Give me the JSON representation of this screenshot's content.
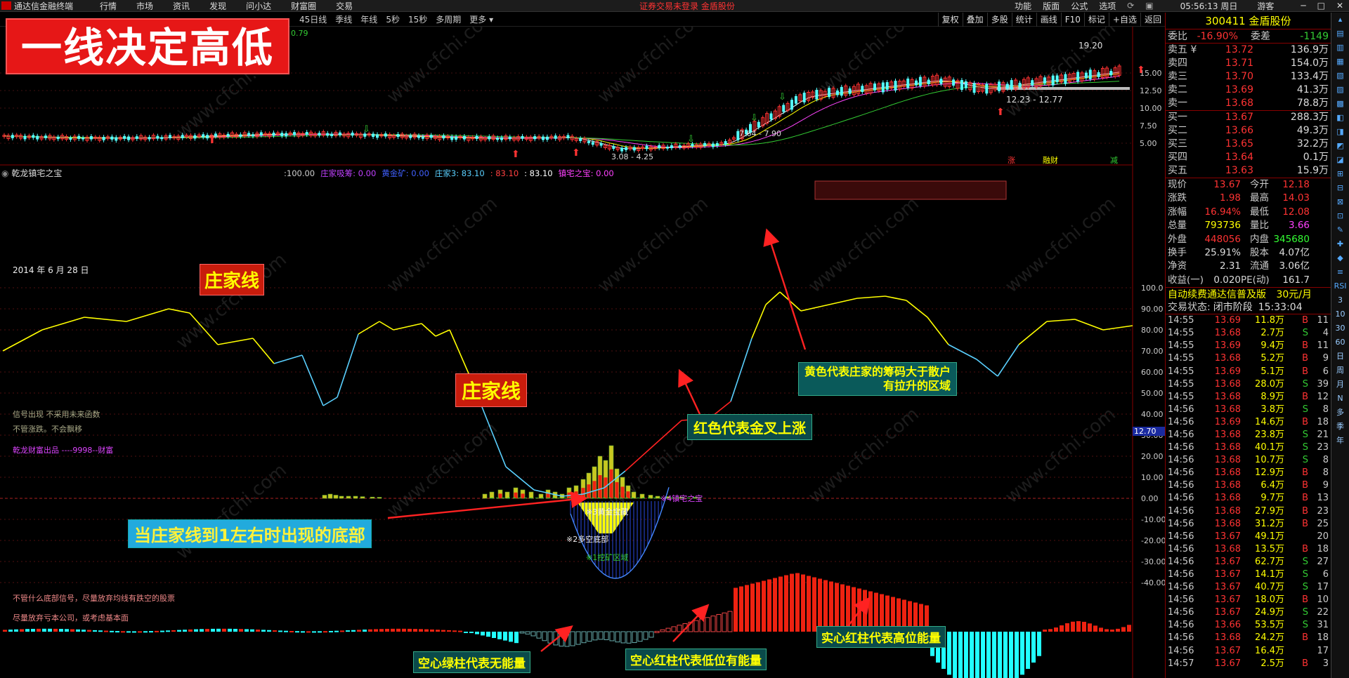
{
  "menubar": {
    "app_title": "通达信金融终端",
    "items": [
      "行情",
      "市场",
      "资讯",
      "发现",
      "问小达",
      "财富圈",
      "交易"
    ],
    "notice": "证券交易未登录  金盾股份",
    "right_items": [
      "功能",
      "版面",
      "公式",
      "选项"
    ],
    "time": "05:56:13 周日",
    "user": "游客"
  },
  "period_bar": {
    "periods": [
      "45日线",
      "季线",
      "年线",
      "5秒",
      "15秒",
      "多周期",
      "更多"
    ],
    "tools": [
      "复权",
      "叠加",
      "多股",
      "统计",
      "画线",
      "F10",
      "标记",
      "+自选",
      "返回"
    ]
  },
  "banner": {
    "text": "一线决定高低"
  },
  "kline": {
    "price_labels": [
      "15.00",
      "12.50",
      "10.00",
      "7.50",
      "5.00"
    ],
    "high_label": "19.20",
    "range_label_1": "12.23 - 12.77",
    "range_label_2": "7.64 - 7.90",
    "range_label_3": "3.08 - 4.25",
    "ma_value": "0.79",
    "event_labels": [
      "涨",
      "融财",
      "减"
    ]
  },
  "indicator": {
    "name": "乾龙镇宅之宝",
    "values_line": [
      {
        "text": ":100.00",
        "color": "#cccccc"
      },
      {
        "text": "庄家吸筹: 0.00",
        "color": "#c040ff"
      },
      {
        "text": "黄金矿: 0.00",
        "color": "#4060ff"
      },
      {
        "text": "庄家3: 83.10",
        "color": "#5ad0ff"
      },
      {
        "text": ": 83.10",
        "color": "#ff4040"
      },
      {
        "text": ": 83.10",
        "color": "#ffffff"
      },
      {
        "text": "镇宅之宝: 0.00",
        "color": "#ff40ff"
      }
    ],
    "axis_labels": [
      "100.0",
      "90.00",
      "80.00",
      "70.00",
      "60.00",
      "50.00",
      "40.00",
      "30.00",
      "20.00",
      "10.00",
      "0.00",
      "-10.00",
      "-20.00",
      "-30.00",
      "-40.00"
    ],
    "current_marker": "12.70",
    "date_label": "2014 年 6 月 28 日",
    "note_1": "信号出现 不采用未来函数",
    "note_2": "不管涨跌。不会飘移",
    "note_3": "乾龙财富出品 ----9998--财富",
    "note_4": "不管什么底部信号，尽量放弃均线有跌空的股票",
    "note_5": "尽量放弃亏本公司，或考虑基本面",
    "zone_1": "※3黄金宝藏",
    "zone_2": "※2多空底部",
    "zone_3": "※1挖矿区域",
    "zone_4": "※4镇宅之宝"
  },
  "annotations": {
    "zhuangjia_1": "庄家线",
    "zhuangjia_2": "庄家线",
    "yellow_line": "黄色代表庄家的筹码大于散户",
    "yellow_line_2": "有拉升的区域",
    "red_line": "红色代表金叉上涨",
    "bottom": "当庄家线到1左右时出现的底部",
    "hollow_green": "空心绿柱代表无能量",
    "hollow_red": "空心红柱代表低位有能量",
    "solid_red": "实心红柱代表高位能量"
  },
  "watermark": "www.cfchi.com",
  "quote": {
    "code": "300411",
    "name": "金盾股份",
    "wei_bi_label": "委比",
    "wei_bi": "-16.90%",
    "wei_cha_label": "委差",
    "wei_cha": "-1149",
    "asks": [
      {
        "label": "卖五 ¥",
        "price": "13.72",
        "vol": "136.9万"
      },
      {
        "label": "卖四",
        "price": "13.71",
        "vol": "154.0万"
      },
      {
        "label": "卖三",
        "price": "13.70",
        "vol": "133.4万"
      },
      {
        "label": "卖二",
        "price": "13.69",
        "vol": "41.3万"
      },
      {
        "label": "卖一",
        "price": "13.68",
        "vol": "78.8万"
      }
    ],
    "bids": [
      {
        "label": "买一",
        "price": "13.67",
        "vol": "288.3万"
      },
      {
        "label": "买二",
        "price": "13.66",
        "vol": "49.3万"
      },
      {
        "label": "买三",
        "price": "13.65",
        "vol": "32.2万"
      },
      {
        "label": "买四",
        "price": "13.64",
        "vol": "0.1万"
      },
      {
        "label": "买五",
        "price": "13.63",
        "vol": "15.9万"
      }
    ],
    "stats": [
      {
        "a": "现价",
        "av": "13.67",
        "ac": "#ff3333",
        "b": "今开",
        "bv": "12.18",
        "bc": "#ff3333"
      },
      {
        "a": "涨跌",
        "av": "1.98",
        "ac": "#ff3333",
        "b": "最高",
        "bv": "14.03",
        "bc": "#ff3333"
      },
      {
        "a": "涨幅",
        "av": "16.94%",
        "ac": "#ff3333",
        "b": "最低",
        "bv": "12.08",
        "bc": "#ff3333"
      },
      {
        "a": "总量",
        "av": "793736",
        "ac": "#ffff00",
        "b": "量比",
        "bv": "3.66",
        "bc": "#ff40ff"
      },
      {
        "a": "外盘",
        "av": "448056",
        "ac": "#ff3333",
        "b": "内盘",
        "bv": "345680",
        "bc": "#33ff33"
      },
      {
        "a": "换手",
        "av": "25.91%",
        "ac": "#dddddd",
        "b": "股本",
        "bv": "4.07亿",
        "bc": "#dddddd"
      },
      {
        "a": "净资",
        "av": "2.31",
        "ac": "#dddddd",
        "b": "流通",
        "bv": "3.06亿",
        "bc": "#dddddd"
      },
      {
        "a": "收益(一)",
        "av": "0.020",
        "ac": "#dddddd",
        "b": "PE(动)",
        "bv": "161.7",
        "bc": "#dddddd"
      }
    ],
    "promo": "自动续费通达信普及版",
    "promo_price": "30元/月",
    "trade_status_label": "交易状态:",
    "trade_status": "闭市阶段",
    "trade_status_time": "15:33:04",
    "ticks": [
      {
        "t": "14:55",
        "p": "13.69",
        "v": "11.8万",
        "bs": "B",
        "n": "11"
      },
      {
        "t": "14:55",
        "p": "13.68",
        "v": "2.7万",
        "bs": "S",
        "n": "4"
      },
      {
        "t": "14:55",
        "p": "13.69",
        "v": "9.4万",
        "bs": "B",
        "n": "11"
      },
      {
        "t": "14:55",
        "p": "13.68",
        "v": "5.2万",
        "bs": "B",
        "n": "9"
      },
      {
        "t": "14:55",
        "p": "13.69",
        "v": "5.1万",
        "bs": "B",
        "n": "6"
      },
      {
        "t": "14:55",
        "p": "13.68",
        "v": "28.0万",
        "bs": "S",
        "n": "39"
      },
      {
        "t": "14:55",
        "p": "13.68",
        "v": "8.9万",
        "bs": "B",
        "n": "12"
      },
      {
        "t": "14:56",
        "p": "13.68",
        "v": "3.8万",
        "bs": "S",
        "n": "8"
      },
      {
        "t": "14:56",
        "p": "13.69",
        "v": "14.6万",
        "bs": "B",
        "n": "18"
      },
      {
        "t": "14:56",
        "p": "13.68",
        "v": "23.8万",
        "bs": "S",
        "n": "21"
      },
      {
        "t": "14:56",
        "p": "13.68",
        "v": "40.1万",
        "bs": "S",
        "n": "23"
      },
      {
        "t": "14:56",
        "p": "13.68",
        "v": "10.7万",
        "bs": "S",
        "n": "8"
      },
      {
        "t": "14:56",
        "p": "13.68",
        "v": "12.9万",
        "bs": "B",
        "n": "8"
      },
      {
        "t": "14:56",
        "p": "13.68",
        "v": "6.4万",
        "bs": "B",
        "n": "9"
      },
      {
        "t": "14:56",
        "p": "13.68",
        "v": "9.7万",
        "bs": "B",
        "n": "13"
      },
      {
        "t": "14:56",
        "p": "13.68",
        "v": "27.9万",
        "bs": "B",
        "n": "23"
      },
      {
        "t": "14:56",
        "p": "13.68",
        "v": "31.2万",
        "bs": "B",
        "n": "25"
      },
      {
        "t": "14:56",
        "p": "13.67",
        "v": "49.1万",
        "bs": "",
        "n": "20"
      },
      {
        "t": "14:56",
        "p": "13.68",
        "v": "13.5万",
        "bs": "B",
        "n": "18"
      },
      {
        "t": "14:56",
        "p": "13.67",
        "v": "62.7万",
        "bs": "S",
        "n": "27"
      },
      {
        "t": "14:56",
        "p": "13.67",
        "v": "14.1万",
        "bs": "S",
        "n": "6"
      },
      {
        "t": "14:56",
        "p": "13.67",
        "v": "40.7万",
        "bs": "S",
        "n": "17"
      },
      {
        "t": "14:56",
        "p": "13.67",
        "v": "18.0万",
        "bs": "B",
        "n": "10"
      },
      {
        "t": "14:56",
        "p": "13.67",
        "v": "24.9万",
        "bs": "S",
        "n": "22"
      },
      {
        "t": "14:56",
        "p": "13.66",
        "v": "53.5万",
        "bs": "S",
        "n": "31"
      },
      {
        "t": "14:56",
        "p": "13.68",
        "v": "24.2万",
        "bs": "B",
        "n": "18"
      },
      {
        "t": "14:56",
        "p": "13.67",
        "v": "16.4万",
        "bs": "",
        "n": "17"
      },
      {
        "t": "14:57",
        "p": "13.67",
        "v": "2.5万",
        "bs": "B",
        "n": "3"
      }
    ]
  },
  "side_icons": [
    "RSI",
    "3",
    "10",
    "30",
    "60",
    "日",
    "周",
    "月",
    "N",
    "多",
    "季",
    "年"
  ]
}
